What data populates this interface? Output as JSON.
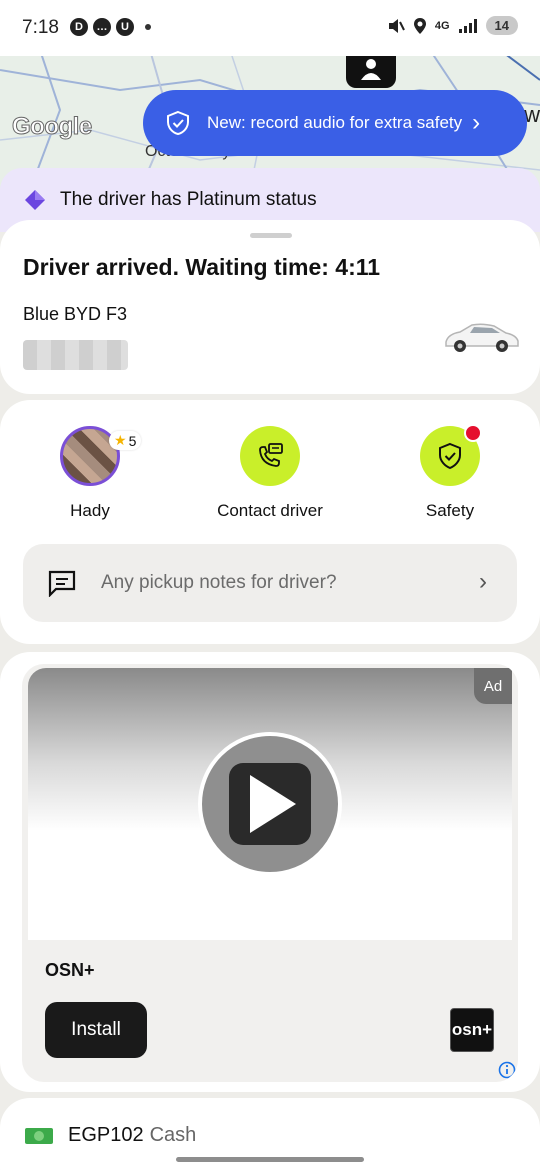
{
  "status_bar": {
    "time": "7:18",
    "network": "4G",
    "battery": "14"
  },
  "map": {
    "label_city_right": "New",
    "label_city_left": "October city",
    "attribution": "Google"
  },
  "safety_banner": {
    "text": "New: record audio for extra safety"
  },
  "platinum": {
    "text": "The driver has Platinum status"
  },
  "trip": {
    "status": "Driver arrived. Waiting time: 4:11",
    "car_model": "Blue BYD F3"
  },
  "actions": {
    "driver_name": "Hady",
    "driver_rating": "5",
    "contact_label": "Contact driver",
    "safety_label": "Safety"
  },
  "notes": {
    "placeholder": "Any pickup notes for driver?"
  },
  "ad": {
    "tag": "Ad",
    "name": "OSN+",
    "install_label": "Install",
    "logo_text": "osn+"
  },
  "payment": {
    "amount": "EGP102",
    "method": "Cash"
  },
  "colors": {
    "accent_blue": "#3a5fe6",
    "lime": "#c9ef2a",
    "platinum_bg": "#ece6fb",
    "alert_red": "#e5102e"
  }
}
